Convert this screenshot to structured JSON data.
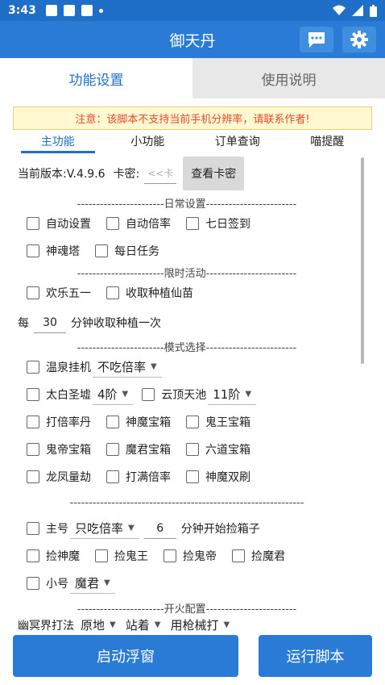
{
  "status": {
    "time": "3:43"
  },
  "app": {
    "title": "御天丹"
  },
  "tabs": [
    {
      "label": "功能设置"
    },
    {
      "label": "使用说明"
    }
  ],
  "notice": "注意：该脚本不支持当前手机分辨率，请联系作者!",
  "subtabs": [
    {
      "label": "主功能"
    },
    {
      "label": "小功能"
    },
    {
      "label": "订单查询"
    },
    {
      "label": "喵提醒"
    }
  ],
  "version": {
    "text": "当前版本:V.4.9.6",
    "card_label": "卡密:",
    "card_placeholder": "<<卡",
    "check_button": "查看卡密"
  },
  "sections": {
    "daily": "-----------------------日常设置------------------------",
    "limited": "-----------------------限时活动------------------------",
    "mode": "-----------------------模式选择------------------------",
    "blank": "--------------------------------------------------------------",
    "fire": "-----------------------开火配置------------------------"
  },
  "daily": {
    "auto_settings": "自动设置",
    "auto_rate": "自动倍率",
    "seven_day": "七日签到",
    "soul_tower": "神魂塔",
    "daily_task": "每日任务"
  },
  "limited": {
    "happy_may": "欢乐五一",
    "harvest_plant": "收取种植仙苗"
  },
  "harvest": {
    "prefix": "每",
    "minutes": "30",
    "suffix": "分钟收取种植一次"
  },
  "mode": {
    "hot_spring": "温泉挂机",
    "hot_spring_select": "不吃倍率",
    "taibai": "太白圣墟",
    "taibai_select": "4阶",
    "cloud_top": "云顶天池",
    "cloud_top_select": "11阶",
    "rate_dan": "打倍率丹",
    "god_demon_box": "神魔宝箱",
    "ghost_king_box": "鬼王宝箱",
    "ghost_emperor_box": "鬼帝宝箱",
    "demon_lord_box": "魔君宝箱",
    "six_way_box": "六道宝箱",
    "dragon_phoenix": "龙凤量劫",
    "full_rate": "打满倍率",
    "god_demon_double": "神魔双刷"
  },
  "main_account": {
    "label": "主号",
    "select": "只吃倍率",
    "minutes": "6",
    "suffix": "分钟开始捡箱子"
  },
  "pickup": {
    "god_demon": "捡神魔",
    "ghost_king": "捡鬼王",
    "ghost_emperor": "捡鬼帝",
    "demon_lord": "捡魔君"
  },
  "alt_account": {
    "label": "小号",
    "select": "魔君"
  },
  "fire": {
    "label": "幽冥界打法",
    "select1": "原地",
    "select2": "站着",
    "select3": "用枪械打"
  },
  "buttons": {
    "float": "启动浮窗",
    "run": "运行脚本"
  }
}
